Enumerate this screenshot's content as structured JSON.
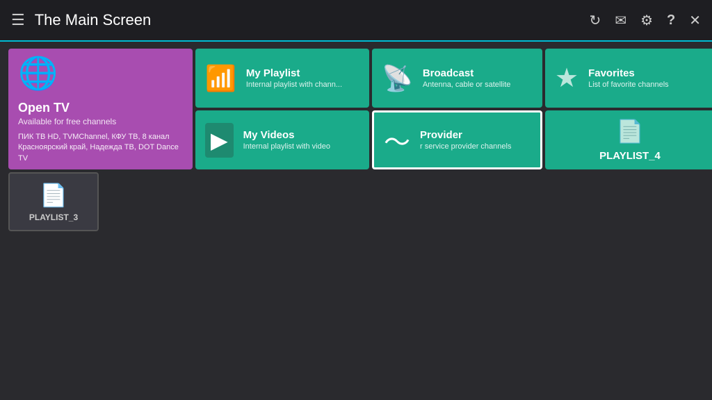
{
  "header": {
    "title": "The Main Screen",
    "actions": [
      "refresh",
      "mail",
      "settings",
      "help",
      "close"
    ]
  },
  "cards": {
    "open_tv": {
      "title": "Open TV",
      "subtitle": "Available for free channels",
      "channels": "ПИК ТВ HD, TVMChannel, КФУ ТВ, 8 канал Красноярский край, Надежда ТВ, DOT Dance TV"
    },
    "my_playlist": {
      "title": "My Playlist",
      "subtitle": "Internal playlist with chann..."
    },
    "broadcast": {
      "title": "Broadcast",
      "subtitle": "Antenna, cable or satellite"
    },
    "favorites": {
      "title": "Favorites",
      "subtitle": "List of favorite channels"
    },
    "my_videos": {
      "title": "My Videos",
      "subtitle": "Internal playlist with video"
    },
    "provider": {
      "title": "Provider",
      "subtitle": "r service provider channels"
    },
    "playlist4": {
      "title": "PLAYLIST_4"
    },
    "playlist3": {
      "title": "PLAYLIST_3"
    }
  }
}
